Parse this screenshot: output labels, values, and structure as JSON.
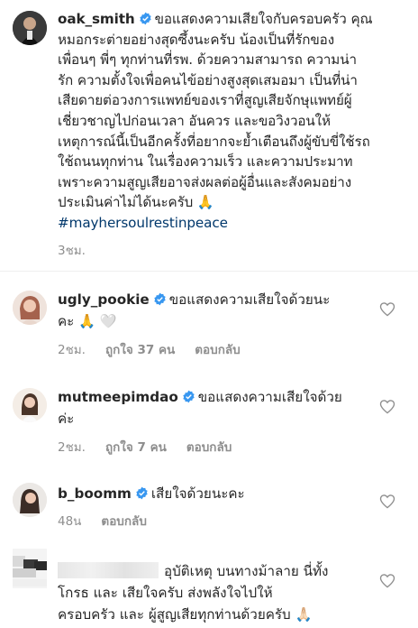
{
  "post": {
    "username": "oak_smith",
    "caption_lines": [
      "ขอแสดงความเสียใจกับครอบครัว คุณ",
      "หมอกระต่ายอย่างสุดซึ้งนะครับ น้องเป็นที่รักของ",
      "เพื่อนๆ พี่ๆ ทุกท่านที่รพ. ด้วยความสามารถ ความน่า",
      "รัก ความตั้งใจเพื่อคนไข้อย่างสูงสุดเสมอมา เป็นที่น่า",
      "เสียดายต่อวงการแพทย์ของเราที่สูญเสียจักษุแพทย์ผู้",
      "เชี่ยวชาญไปก่อนเวลา อันควร และขอวิงวอนให้",
      "เหตุการณ์นี้เป็นอีกครั้งที่อยากจะย้ำเตือนถึงผู้ขับขี่ใช้รถ",
      "ใช้ถนนทุกท่าน ในเรื่องความเร็ว และความประมาท",
      "เพราะความสูญเสียอาจส่งผลต่อผู้อื่นและสังคมอย่าง",
      "ประเมินค่าไม่ได้นะครับ 🙏"
    ],
    "hashtag": "#mayhersoulrestinpeace",
    "time": "3ชม."
  },
  "comments": [
    {
      "username": "ugly_pookie",
      "line1": "ขอแสดงความเสียใจด้วยนะ",
      "line2": "คะ 🙏 🤍",
      "time": "2ชม.",
      "likes": "ถูกใจ 37 คน",
      "reply": "ตอบกลับ"
    },
    {
      "username": "mutmeepimdao",
      "line1": "ขอแสดงความเสียใจด้วย",
      "line2": "ค่ะ",
      "time": "2ชม.",
      "likes": "ถูกใจ 7 คน",
      "reply": "ตอบกลับ"
    },
    {
      "username": "b_boomm",
      "line1": "เสียใจด้วยนะคะ",
      "time": "48น",
      "reply": "ตอบกลับ"
    },
    {
      "line1": "อุบัติเหตุ บนทางม้าลาย นี่ทั้ง",
      "line2": "โกรธ และ เสียใจครับ ส่งพลังใจไปให้",
      "line3": "ครอบครัว และ ผู้สูญเสียทุกท่านด้วยครับ 🙏🏻"
    }
  ],
  "colors": {
    "verified": "#3897f0",
    "text": "#262626",
    "secondary": "#8e8e8e",
    "hashtag": "#00376b"
  }
}
